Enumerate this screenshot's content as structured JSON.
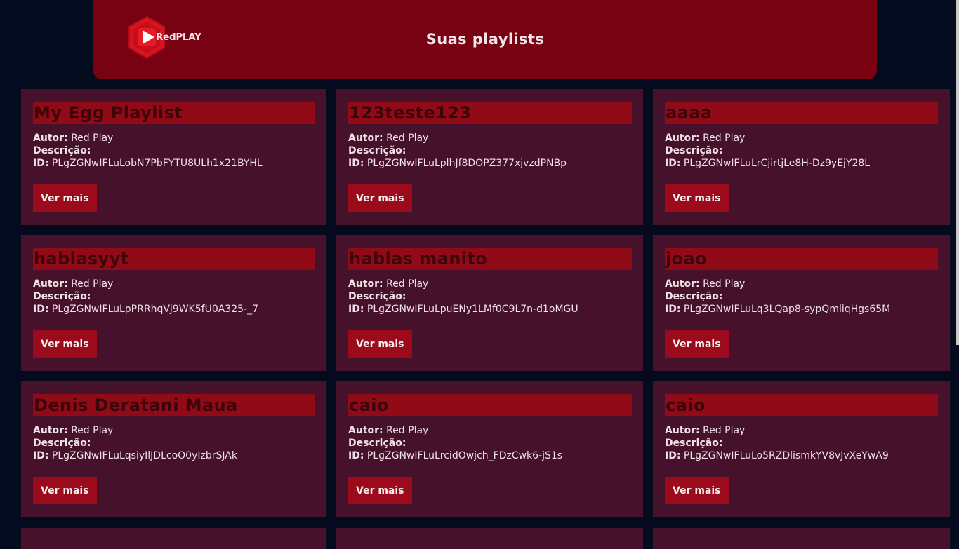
{
  "header": {
    "logo_text": "RedPLAY",
    "title": "Suas playlists"
  },
  "labels": {
    "author": "Autor:",
    "description": "Descrição:",
    "id": "ID:",
    "button": "Ver mais"
  },
  "playlists": [
    {
      "title": "My Egg Playlist",
      "author": "Red Play",
      "description": "",
      "id": "PLgZGNwIFLuLobN7PbFYTU8ULh1x21BYHL"
    },
    {
      "title": "123teste123",
      "author": "Red Play",
      "description": "",
      "id": "PLgZGNwIFLuLplhJf8DOPZ377xjvzdPNBp"
    },
    {
      "title": "aaaa",
      "author": "Red Play",
      "description": "",
      "id": "PLgZGNwIFLuLrCjirtjLe8H-Dz9yEjY28L"
    },
    {
      "title": "hablasyyt",
      "author": "Red Play",
      "description": "",
      "id": "PLgZGNwIFLuLpPRRhqVj9WK5fU0A325-_7"
    },
    {
      "title": "hablas manito",
      "author": "Red Play",
      "description": "",
      "id": "PLgZGNwIFLuLpuENy1LMf0C9L7n-d1oMGU"
    },
    {
      "title": "joao",
      "author": "Red Play",
      "description": "",
      "id": "PLgZGNwIFLuLq3LQap8-sypQmliqHgs65M"
    },
    {
      "title": "Denis Deratani Maua",
      "author": "Red Play",
      "description": "",
      "id": "PLgZGNwIFLuLqsiyIlJDLcoO0yIzbrSJAk"
    },
    {
      "title": "caio",
      "author": "Red Play",
      "description": "",
      "id": "PLgZGNwIFLuLrcidOwjch_FDzCwk6-jS1s"
    },
    {
      "title": "caio",
      "author": "Red Play",
      "description": "",
      "id": "PLgZGNwIFLuLo5RZDlismkYV8vJvXeYwA9"
    }
  ]
}
